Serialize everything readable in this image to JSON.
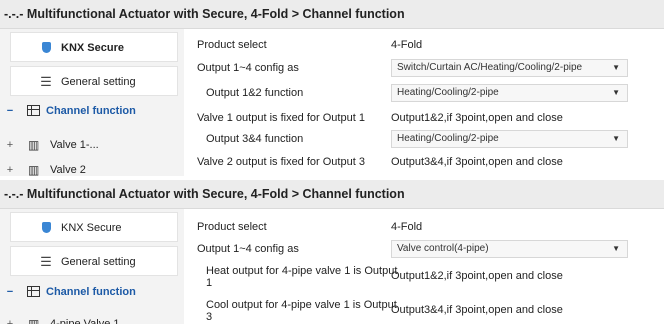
{
  "panel1": {
    "title": "-.-.- Multifunctional Actuator with Secure, 4-Fold > Channel function",
    "sidebar": {
      "knx_secure": "KNX Secure",
      "general_setting": "General setting",
      "channel_function": "Channel function",
      "channel_function_toggle": "−",
      "valve1_toggle": "+",
      "valve1": "Valve 1-...",
      "valve2_toggle": "+",
      "valve2": "Valve 2"
    },
    "rows": {
      "product_select_label": "Product select",
      "product_select_value": "4-Fold",
      "output_config_label": "Output 1~4 config as",
      "output_config_value": "Switch/Curtain AC/Heating/Cooling/2-pipe",
      "output12_label": "Output 1&2 function",
      "output12_value": "Heating/Cooling/2-pipe",
      "valve1_fixed_label": "Valve 1 output is fixed for Output 1",
      "valve1_fixed_value": "Output1&2,if 3point,open and close",
      "output34_label": "Output 3&4 function",
      "output34_value": "Heating/Cooling/2-pipe",
      "valve2_fixed_label": "Valve 2 output is fixed for Output 3",
      "valve2_fixed_value": "Output3&4,if 3point,open and close"
    }
  },
  "panel2": {
    "title": "-.-.- Multifunctional Actuator with Secure, 4-Fold > Channel function",
    "sidebar": {
      "knx_secure": "KNX Secure",
      "general_setting": "General setting",
      "channel_function": "Channel function",
      "channel_function_toggle": "−",
      "valve1_toggle": "+",
      "valve1": "4-pipe Valve 1"
    },
    "rows": {
      "product_select_label": "Product select",
      "product_select_value": "4-Fold",
      "output_config_label": "Output 1~4 config as",
      "output_config_value": "Valve control(4-pipe)",
      "heat_output_label": "Heat output for 4-pipe valve 1 is Output 1",
      "heat_output_value": "Output1&2,if 3point,open and close",
      "cool_output_label": "Cool output for 4-pipe valve 1 is Output 3",
      "cool_output_value": "Output3&4,if 3point,open and close"
    }
  },
  "icons": {
    "dropdown_arrow": "▼",
    "gear": "☰",
    "valve": "▥"
  },
  "colors": {
    "accent": "#1d5aa6",
    "shield": "#3a86d4",
    "sidebar_bg": "#f3f3f3",
    "titlebar_bg": "#ececec"
  }
}
